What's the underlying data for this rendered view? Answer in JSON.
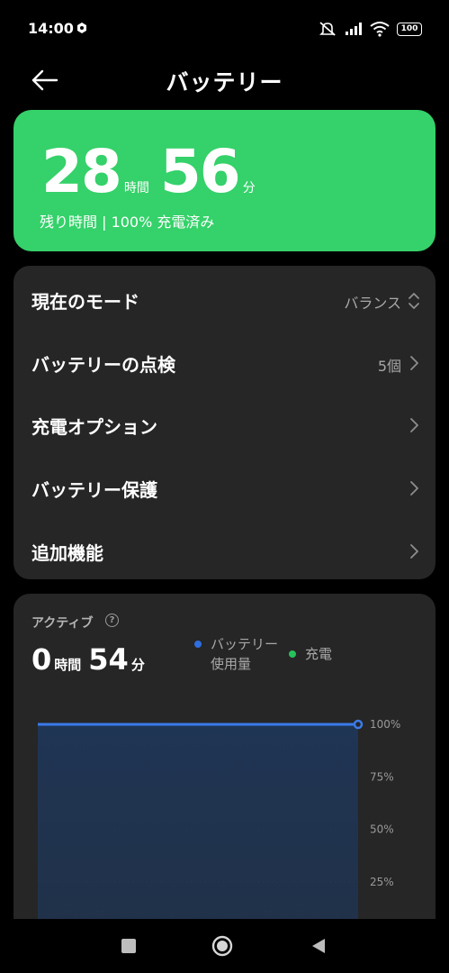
{
  "status_bar": {
    "time": "14:00",
    "battery_level": "100",
    "icons": [
      "app-notification-icon",
      "mute-icon",
      "signal-icon",
      "wifi-icon",
      "battery-icon"
    ]
  },
  "header": {
    "title": "バッテリー",
    "back_icon": "back-arrow-icon"
  },
  "battery_card": {
    "hours": "28",
    "hours_unit": "時間",
    "minutes": "56",
    "minutes_unit": "分",
    "subtitle": "残り時間 | 100% 充電済み",
    "color": "#35d16a"
  },
  "settings": {
    "items": [
      {
        "label": "現在のモード",
        "value": "バランス",
        "icon": "up-down-chevron-icon"
      },
      {
        "label": "バッテリーの点検",
        "value": "5個",
        "icon": "chevron-right-icon"
      },
      {
        "label": "充電オプション",
        "value": "",
        "icon": "chevron-right-icon"
      },
      {
        "label": "バッテリー保護",
        "value": "",
        "icon": "chevron-right-icon"
      },
      {
        "label": "追加機能",
        "value": "",
        "icon": "chevron-right-icon"
      }
    ]
  },
  "activity": {
    "label": "アクティブ",
    "help_icon": "?",
    "hours": "0",
    "hours_unit": "時間",
    "minutes": "54",
    "minutes_unit": "分",
    "legend": {
      "usage": "バッテリー使用量",
      "usage_color": "#2f6ee0",
      "charge": "充電",
      "charge_color": "#27c15c"
    }
  },
  "chart_data": {
    "type": "area",
    "series": [
      {
        "name": "バッテリー使用量",
        "values": [
          100,
          100
        ]
      }
    ],
    "y_tick_labels": [
      "100%",
      "75%",
      "50%",
      "25%"
    ],
    "y_ticks": [
      100,
      75,
      50,
      25
    ],
    "ylim": [
      0,
      100
    ],
    "line_color": "#3b7bea",
    "fill_color": "#1f3554"
  },
  "nav_bar": {
    "buttons": [
      "recent-apps-icon",
      "home-icon",
      "back-icon"
    ]
  }
}
